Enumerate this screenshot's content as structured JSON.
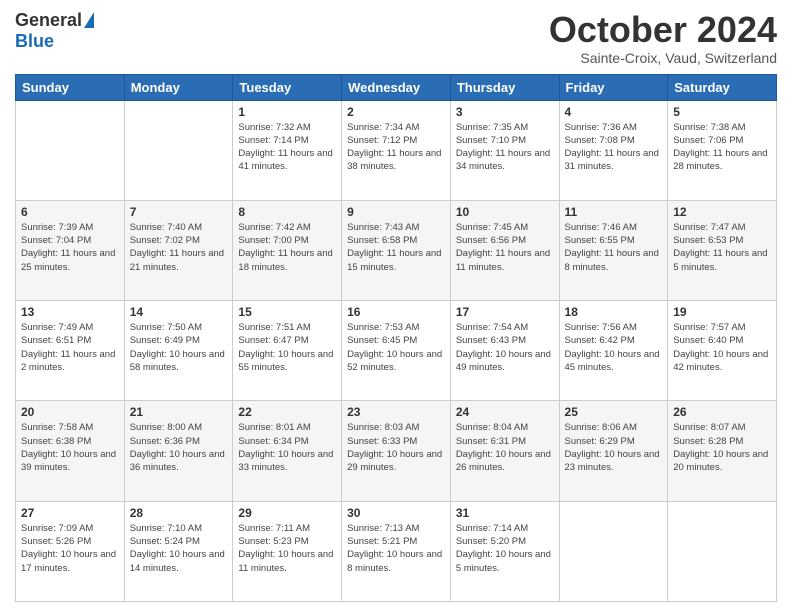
{
  "logo": {
    "general": "General",
    "blue": "Blue"
  },
  "header": {
    "month": "October 2024",
    "location": "Sainte-Croix, Vaud, Switzerland"
  },
  "weekdays": [
    "Sunday",
    "Monday",
    "Tuesday",
    "Wednesday",
    "Thursday",
    "Friday",
    "Saturday"
  ],
  "weeks": [
    [
      {
        "day": "",
        "detail": ""
      },
      {
        "day": "",
        "detail": ""
      },
      {
        "day": "1",
        "detail": "Sunrise: 7:32 AM\nSunset: 7:14 PM\nDaylight: 11 hours and 41 minutes."
      },
      {
        "day": "2",
        "detail": "Sunrise: 7:34 AM\nSunset: 7:12 PM\nDaylight: 11 hours and 38 minutes."
      },
      {
        "day": "3",
        "detail": "Sunrise: 7:35 AM\nSunset: 7:10 PM\nDaylight: 11 hours and 34 minutes."
      },
      {
        "day": "4",
        "detail": "Sunrise: 7:36 AM\nSunset: 7:08 PM\nDaylight: 11 hours and 31 minutes."
      },
      {
        "day": "5",
        "detail": "Sunrise: 7:38 AM\nSunset: 7:06 PM\nDaylight: 11 hours and 28 minutes."
      }
    ],
    [
      {
        "day": "6",
        "detail": "Sunrise: 7:39 AM\nSunset: 7:04 PM\nDaylight: 11 hours and 25 minutes."
      },
      {
        "day": "7",
        "detail": "Sunrise: 7:40 AM\nSunset: 7:02 PM\nDaylight: 11 hours and 21 minutes."
      },
      {
        "day": "8",
        "detail": "Sunrise: 7:42 AM\nSunset: 7:00 PM\nDaylight: 11 hours and 18 minutes."
      },
      {
        "day": "9",
        "detail": "Sunrise: 7:43 AM\nSunset: 6:58 PM\nDaylight: 11 hours and 15 minutes."
      },
      {
        "day": "10",
        "detail": "Sunrise: 7:45 AM\nSunset: 6:56 PM\nDaylight: 11 hours and 11 minutes."
      },
      {
        "day": "11",
        "detail": "Sunrise: 7:46 AM\nSunset: 6:55 PM\nDaylight: 11 hours and 8 minutes."
      },
      {
        "day": "12",
        "detail": "Sunrise: 7:47 AM\nSunset: 6:53 PM\nDaylight: 11 hours and 5 minutes."
      }
    ],
    [
      {
        "day": "13",
        "detail": "Sunrise: 7:49 AM\nSunset: 6:51 PM\nDaylight: 11 hours and 2 minutes."
      },
      {
        "day": "14",
        "detail": "Sunrise: 7:50 AM\nSunset: 6:49 PM\nDaylight: 10 hours and 58 minutes."
      },
      {
        "day": "15",
        "detail": "Sunrise: 7:51 AM\nSunset: 6:47 PM\nDaylight: 10 hours and 55 minutes."
      },
      {
        "day": "16",
        "detail": "Sunrise: 7:53 AM\nSunset: 6:45 PM\nDaylight: 10 hours and 52 minutes."
      },
      {
        "day": "17",
        "detail": "Sunrise: 7:54 AM\nSunset: 6:43 PM\nDaylight: 10 hours and 49 minutes."
      },
      {
        "day": "18",
        "detail": "Sunrise: 7:56 AM\nSunset: 6:42 PM\nDaylight: 10 hours and 45 minutes."
      },
      {
        "day": "19",
        "detail": "Sunrise: 7:57 AM\nSunset: 6:40 PM\nDaylight: 10 hours and 42 minutes."
      }
    ],
    [
      {
        "day": "20",
        "detail": "Sunrise: 7:58 AM\nSunset: 6:38 PM\nDaylight: 10 hours and 39 minutes."
      },
      {
        "day": "21",
        "detail": "Sunrise: 8:00 AM\nSunset: 6:36 PM\nDaylight: 10 hours and 36 minutes."
      },
      {
        "day": "22",
        "detail": "Sunrise: 8:01 AM\nSunset: 6:34 PM\nDaylight: 10 hours and 33 minutes."
      },
      {
        "day": "23",
        "detail": "Sunrise: 8:03 AM\nSunset: 6:33 PM\nDaylight: 10 hours and 29 minutes."
      },
      {
        "day": "24",
        "detail": "Sunrise: 8:04 AM\nSunset: 6:31 PM\nDaylight: 10 hours and 26 minutes."
      },
      {
        "day": "25",
        "detail": "Sunrise: 8:06 AM\nSunset: 6:29 PM\nDaylight: 10 hours and 23 minutes."
      },
      {
        "day": "26",
        "detail": "Sunrise: 8:07 AM\nSunset: 6:28 PM\nDaylight: 10 hours and 20 minutes."
      }
    ],
    [
      {
        "day": "27",
        "detail": "Sunrise: 7:09 AM\nSunset: 5:26 PM\nDaylight: 10 hours and 17 minutes."
      },
      {
        "day": "28",
        "detail": "Sunrise: 7:10 AM\nSunset: 5:24 PM\nDaylight: 10 hours and 14 minutes."
      },
      {
        "day": "29",
        "detail": "Sunrise: 7:11 AM\nSunset: 5:23 PM\nDaylight: 10 hours and 11 minutes."
      },
      {
        "day": "30",
        "detail": "Sunrise: 7:13 AM\nSunset: 5:21 PM\nDaylight: 10 hours and 8 minutes."
      },
      {
        "day": "31",
        "detail": "Sunrise: 7:14 AM\nSunset: 5:20 PM\nDaylight: 10 hours and 5 minutes."
      },
      {
        "day": "",
        "detail": ""
      },
      {
        "day": "",
        "detail": ""
      }
    ]
  ]
}
